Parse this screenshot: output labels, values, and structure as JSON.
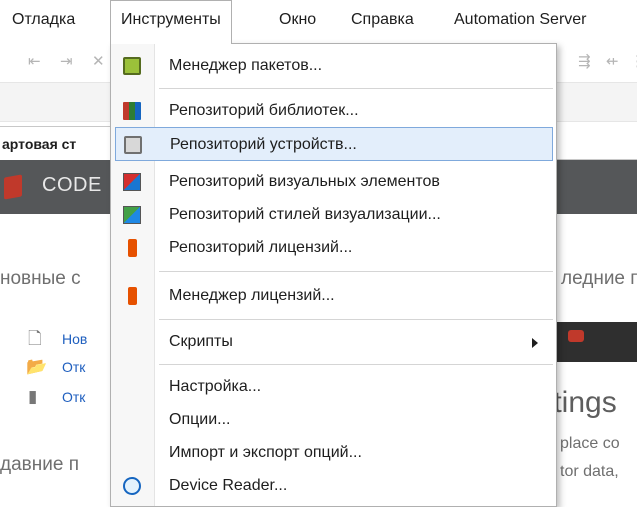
{
  "menubar": {
    "items": [
      {
        "label": "Отладка"
      },
      {
        "label": "Инструменты"
      },
      {
        "label": "Окно"
      },
      {
        "label": "Справка"
      },
      {
        "label": "Automation Server"
      }
    ]
  },
  "tab": {
    "label": "артовая ст"
  },
  "banner": {
    "brand": "CODE"
  },
  "page": {
    "section1": "новные с",
    "section1_right": "ледние п",
    "links": [
      "Нов",
      "Отк",
      "Отк"
    ],
    "section2": "давние п",
    "settings_title": "ttings",
    "settings_line1": "place co",
    "settings_line2": "tor data,"
  },
  "dropdown": {
    "items": [
      {
        "label": "Менеджер пакетов...",
        "icon": "package-icon"
      },
      {
        "label": "Репозиторий библиотек...",
        "icon": "library-icon"
      },
      {
        "label": "Репозиторий устройств...",
        "icon": "device-icon",
        "highlighted": true
      },
      {
        "label": "Репозиторий визуальных элементов",
        "icon": "visual-elements-icon"
      },
      {
        "label": "Репозиторий стилей визуализации...",
        "icon": "visual-styles-icon"
      },
      {
        "label": "Репозиторий лицензий...",
        "icon": "license-icon"
      },
      {
        "label": "Менеджер лицензий...",
        "icon": "license-manager-icon"
      },
      {
        "label": "Скрипты",
        "submenu": true
      },
      {
        "label": "Настройка..."
      },
      {
        "label": "Опции..."
      },
      {
        "label": "Импорт и экспорт опций..."
      },
      {
        "label": "Device Reader...",
        "icon": "device-reader-icon"
      }
    ]
  }
}
